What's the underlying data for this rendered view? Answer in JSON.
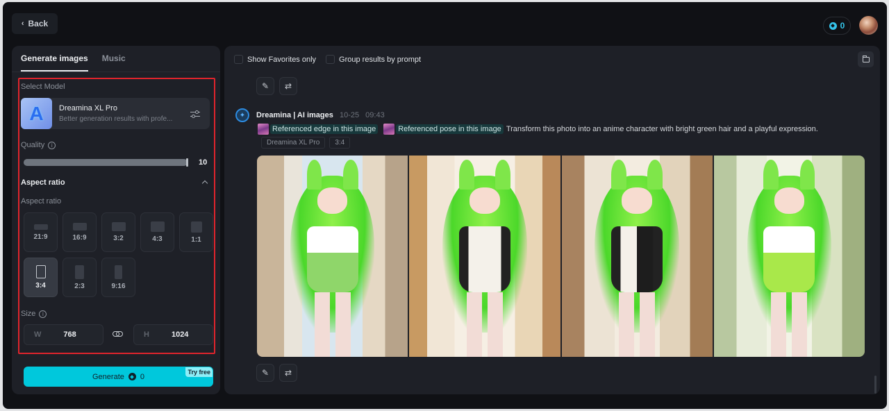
{
  "header": {
    "back_label": "Back",
    "credits": "0"
  },
  "left_panel": {
    "tabs": [
      {
        "label": "Generate images",
        "active": true
      },
      {
        "label": "Music",
        "active": false
      }
    ],
    "select_model_label": "Select Model",
    "model": {
      "name": "Dreamina XL Pro",
      "description": "Better generation results with profe...",
      "thumb_letter": "A"
    },
    "quality": {
      "label": "Quality",
      "value": "10",
      "fraction": 1.0
    },
    "aspect_section_title": "Aspect ratio",
    "aspect_label": "Aspect ratio",
    "aspect_ratios": [
      {
        "label": "21:9",
        "selected": false
      },
      {
        "label": "16:9",
        "selected": false
      },
      {
        "label": "3:2",
        "selected": false
      },
      {
        "label": "4:3",
        "selected": false
      },
      {
        "label": "1:1",
        "selected": false
      },
      {
        "label": "3:4",
        "selected": true
      },
      {
        "label": "2:3",
        "selected": false
      },
      {
        "label": "9:16",
        "selected": false
      }
    ],
    "size": {
      "label": "Size",
      "width_axis": "W",
      "width": "768",
      "height_axis": "H",
      "height": "1024"
    },
    "generate": {
      "label": "Generate",
      "cost": "0",
      "badge": "Try free"
    }
  },
  "right_panel": {
    "filters": {
      "favorites_label": "Show Favorites only",
      "group_label": "Group results by prompt"
    },
    "message": {
      "sender": "Dreamina | AI images",
      "date": "10-25",
      "time": "09:43",
      "references": [
        {
          "label": "Referenced edge in this image"
        },
        {
          "label": "Referenced pose in this image"
        }
      ],
      "prompt": "Transform this photo into an anime character with bright green hair and a playful expression.",
      "tags": [
        "Dreamina XL Pro",
        "3:4"
      ]
    },
    "results": [
      {
        "name": "result-image-1",
        "scene": "street",
        "outfit": "green pleated skirt, white blouse"
      },
      {
        "name": "result-image-2",
        "scene": "hallway",
        "outfit": "white dress, black sleeves"
      },
      {
        "name": "result-image-3",
        "scene": "alley",
        "outfit": "black and white dress"
      },
      {
        "name": "result-image-4",
        "scene": "park",
        "outfit": "lime green skirt, white top"
      }
    ]
  },
  "colors": {
    "accent": "#00c8dc",
    "highlight_border": "#e0242c",
    "background": "#101115",
    "panel": "#1e2027"
  }
}
